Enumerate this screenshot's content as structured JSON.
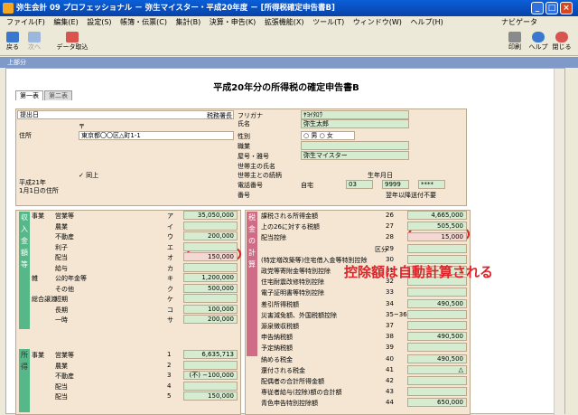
{
  "window": {
    "title": "弥生会計 09 プロフェッショナル － 弥生マイスター・平成20年度 － [所得税確定申告書B]"
  },
  "menu": [
    "ファイル(F)",
    "編集(E)",
    "設定(S)",
    "帳簿・伝票(C)",
    "集計(B)",
    "決算・申告(K)",
    "拡張機能(X)",
    "ツール(T)",
    "ウィンドウ(W)",
    "ヘルプ(H)"
  ],
  "navi_label": "ナビゲータ",
  "toolbar": {
    "back": "戻る",
    "next": "次へ",
    "import": "データ取込",
    "print": "印刷",
    "help": "ヘルプ",
    "close": "閉じる"
  },
  "section_label": "上部分",
  "doc": {
    "title": "平成20年分の所得税の確定申告書B",
    "tab1": "第一表",
    "tab2": "第二表"
  },
  "header": {
    "submit_date": "提出日",
    "tax_office": "税務署長",
    "address_label": "住所",
    "postal": "〒",
    "address": "東京都〇〇区△町1-1",
    "furigana_label": "フリガナ",
    "name_label": "氏名",
    "furigana": "ﾔﾖｲﾀﾛｳ",
    "name": "弥生太郎",
    "sex_label": "性別",
    "male": "男",
    "female": "女",
    "job_label": "職業",
    "shop_label": "屋号・雅号",
    "shop": "弥生マイスター",
    "head_label": "世帯主の氏名",
    "rel_label": "世帯主との続柄",
    "birth_label": "生年月日",
    "phone_label": "電話番号",
    "phone_type": "自宅",
    "phone1": "03",
    "phone2": "9999",
    "phone3": "****",
    "num_label": "番号",
    "next_year": "翌年以降送付不要",
    "same": "同上",
    "jan1": "平成21年\n1月1日の住所"
  },
  "income_rows": [
    {
      "group": "事業",
      "label": "営業等",
      "code": "ア",
      "value": "35,050,000"
    },
    {
      "group": "",
      "label": "農業",
      "code": "イ",
      "value": ""
    },
    {
      "group": "",
      "label": "不動産",
      "code": "ウ",
      "value": "200,000"
    },
    {
      "group": "",
      "label": "利子",
      "code": "エ",
      "value": ""
    },
    {
      "group": "",
      "label": "配当",
      "code": "オ",
      "value": "150,000"
    },
    {
      "group": "",
      "label": "給与",
      "code": "カ",
      "value": ""
    },
    {
      "group": "雑",
      "label": "公的年金等",
      "code": "キ",
      "value": "1,200,000"
    },
    {
      "group": "",
      "label": "その他",
      "code": "ク",
      "value": "500,000"
    },
    {
      "group": "総合譲渡",
      "label": "短期",
      "code": "ケ",
      "value": ""
    },
    {
      "group": "",
      "label": "長期",
      "code": "コ",
      "value": "100,000"
    },
    {
      "group": "",
      "label": "一時",
      "code": "サ",
      "value": "200,000"
    }
  ],
  "income2_rows": [
    {
      "group": "事業",
      "label": "営業等",
      "code": "1",
      "value": "6,635,713"
    },
    {
      "group": "",
      "label": "農業",
      "code": "2",
      "value": ""
    },
    {
      "group": "",
      "label": "不動産",
      "code": "3",
      "value": "(不) −100,000"
    },
    {
      "group": "",
      "label": "配当",
      "code": "4",
      "value": ""
    },
    {
      "group": "",
      "label": "配当",
      "code": "5",
      "value": "150,000"
    }
  ],
  "tax_rows": [
    {
      "label": "課税される所得金額",
      "code": "26",
      "value": "4,665,000"
    },
    {
      "label": "上の26に対する税額",
      "code": "27",
      "value": "505,500"
    },
    {
      "label": "配当控除",
      "code": "28",
      "value": "15,000"
    },
    {
      "label": "",
      "code": "29",
      "value": "",
      "extra": "区分"
    },
    {
      "label": "(特定増改築等)住宅借入金等特別控除",
      "code": "30",
      "value": ""
    },
    {
      "label": "政党等寄附金等特別控除",
      "code": "31",
      "value": ""
    },
    {
      "label": "住宅耐震改修特別控除",
      "code": "32",
      "value": ""
    },
    {
      "label": "電子証明書等特別控除",
      "code": "33",
      "value": ""
    },
    {
      "label": "差引所得税額",
      "code": "34",
      "value": "490,500"
    },
    {
      "label": "災害減免額、外国税額控除",
      "code": "35~36",
      "value": ""
    },
    {
      "label": "源泉徴収税額",
      "code": "37",
      "value": ""
    },
    {
      "label": "申告納税額",
      "code": "38",
      "value": "490,500"
    },
    {
      "label": "予定納税額",
      "code": "39",
      "value": ""
    },
    {
      "label": "納める税金",
      "code": "40",
      "value": "490,500"
    },
    {
      "label": "還付される税金",
      "code": "41",
      "value": "△"
    },
    {
      "label": "配偶者の合計所得金額",
      "code": "42",
      "value": ""
    },
    {
      "label": "専従者給与(控除)額の合計額",
      "code": "43",
      "value": ""
    },
    {
      "label": "青色申告特別控除額",
      "code": "44",
      "value": "650,000"
    }
  ],
  "side_label_income": "収入金額等",
  "side_label_income2": "所得",
  "side_label_tax": "税金の計算",
  "third_period": "第3期分の税額",
  "callout": "控除額は自動計算される"
}
